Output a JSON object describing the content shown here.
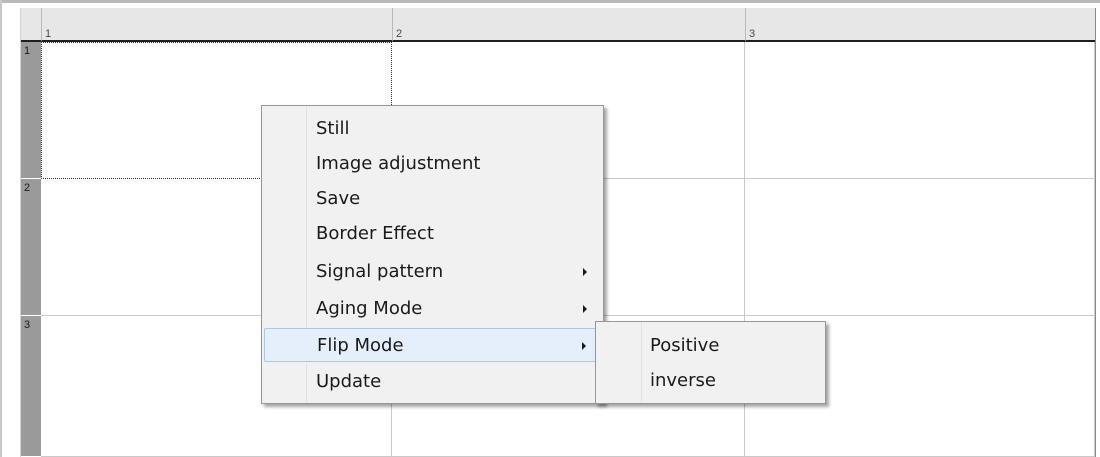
{
  "grid": {
    "columns": [
      "1",
      "2",
      "3"
    ],
    "rows": [
      "1",
      "2",
      "3"
    ]
  },
  "context_menu": {
    "items": [
      {
        "label": "Still",
        "submenu": false
      },
      {
        "label": "Image adjustment",
        "submenu": false
      },
      {
        "label": "Save",
        "submenu": false
      },
      {
        "label": "Border Effect",
        "submenu": false
      },
      {
        "label": "Signal pattern",
        "submenu": true
      },
      {
        "label": "Aging Mode",
        "submenu": true
      },
      {
        "label": "Flip Mode",
        "submenu": true,
        "highlighted": true
      },
      {
        "label": "Update",
        "submenu": false
      }
    ]
  },
  "flip_submenu": {
    "items": [
      {
        "label": "Positive"
      },
      {
        "label": "inverse"
      }
    ]
  }
}
